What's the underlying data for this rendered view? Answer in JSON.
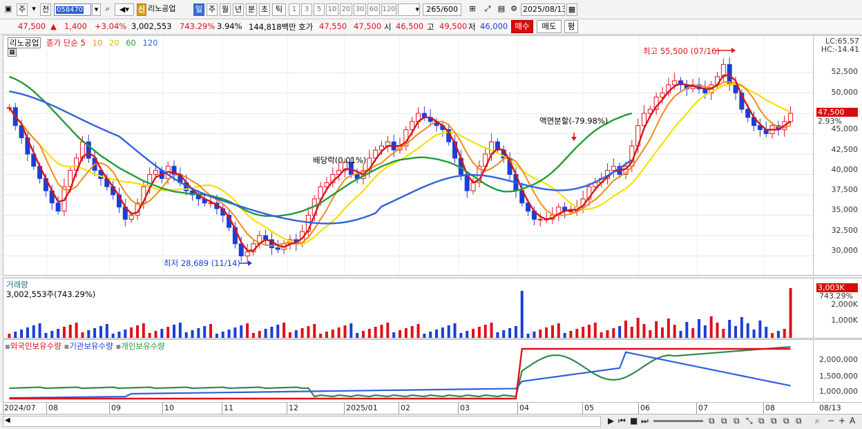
{
  "toolbar": {
    "tab_stock": "주",
    "tab_prev": "전",
    "code": "058470",
    "shin": "신",
    "name": "리노공업",
    "periods": [
      "일",
      "주",
      "월",
      "년",
      "분",
      "초",
      "틱"
    ],
    "intervals": [
      "1",
      "3",
      "5",
      "10",
      "20",
      "30",
      "60",
      "120"
    ],
    "count": "265",
    "count_total": "/600",
    "date": "2025/08/13"
  },
  "quote": {
    "price": "47,500",
    "change": "1,400",
    "change_pct": "+3.04%",
    "volume": "3,002,553",
    "vol_ratio": "743.29%",
    "turnover": "3.94%",
    "amount": "144,818백만",
    "ask_label": "호가",
    "ask1": "47,550",
    "ask2": "47,500",
    "open_label": "시",
    "open": "46,500",
    "high_label": "고",
    "high": "49,500",
    "low_label": "저",
    "low": "46,000",
    "buy_label": "매수",
    "sell_label": "매도",
    "avg_label": "평"
  },
  "legend": {
    "name": "리노공업",
    "series": "종가 단순",
    "ma5": "5",
    "ma10": "10",
    "ma20": "20",
    "ma60": "60",
    "ma120": "120"
  },
  "colors": {
    "up": "#e0101a",
    "down": "#1a3ed8",
    "ma5": "#d81414",
    "ma10": "#f08a1c",
    "ma20": "#f5e000",
    "ma60": "#1f9a3a",
    "ma120": "#3060e0"
  },
  "annotations": {
    "high": "최고 55,500 (07/16)",
    "low": "최저 28,689 (11/14)",
    "dividend": "배당락(0.01%)",
    "split": "액면분할(-79.98%)"
  },
  "right_axis": {
    "lc": "LC:65.57",
    "hc": "HC:-14.41",
    "current": "47,500",
    "current_pct": "2.93%",
    "ticks": [
      "52,500",
      "50,000",
      "47,500",
      "45,000",
      "42,500",
      "40,000",
      "37,500",
      "35,000",
      "32,500",
      "30,000"
    ]
  },
  "volume_panel": {
    "title": "거래량",
    "value": "3,002,553주(743.29%)",
    "current": "3,003K",
    "current_pct": "743.29%",
    "ticks": [
      "2,000K",
      "1,000K"
    ]
  },
  "ownership_panel": {
    "foreign": "외국인보유수량",
    "inst": "기관보유수량",
    "indiv": "개인보유수량",
    "ticks": [
      "2,000,000",
      "1,500,000",
      "1,000,000"
    ]
  },
  "x_axis": {
    "labels": [
      "2024/07",
      "08",
      "09",
      "10",
      "11",
      "12",
      "2025/01",
      "02",
      "03",
      "04",
      "05",
      "06",
      "07",
      "08"
    ],
    "right_label": "08/13"
  },
  "chart_data": {
    "type": "candlestick",
    "y_range": [
      27500,
      57000
    ],
    "y_ticks": [
      30000,
      32500,
      35000,
      37500,
      40000,
      42500,
      45000,
      47500,
      50000,
      52500
    ],
    "closes": [
      48200,
      46000,
      44500,
      42500,
      41000,
      39500,
      38000,
      36500,
      35500,
      38500,
      40500,
      42000,
      44000,
      42000,
      40500,
      39500,
      38500,
      37500,
      36000,
      34500,
      35000,
      36500,
      38500,
      40000,
      40500,
      39500,
      41000,
      40000,
      39000,
      38000,
      37500,
      37000,
      36500,
      36500,
      35800,
      35000,
      33500,
      31500,
      30000,
      30500,
      31500,
      32500,
      32000,
      31000,
      30800,
      31500,
      32000,
      31500,
      33000,
      35000,
      37000,
      38500,
      39000,
      40000,
      40500,
      41500,
      40000,
      39500,
      40500,
      42000,
      43000,
      43500,
      44000,
      43000,
      43500,
      45500,
      46500,
      47500,
      47000,
      46500,
      46000,
      45500,
      44000,
      42000,
      40000,
      38000,
      39000,
      41000,
      42500,
      44000,
      43000,
      42000,
      40000,
      38000,
      36500,
      35500,
      34500,
      34500,
      34500,
      35000,
      36000,
      35500,
      35500,
      36000,
      37000,
      38500,
      39000,
      39500,
      40500,
      41000,
      40000,
      41000,
      43500,
      46000,
      47500,
      48000,
      49500,
      50000,
      51000,
      51500,
      51000,
      50500,
      51000,
      50500,
      50000,
      51000,
      52000,
      53500,
      51000,
      50000,
      48000,
      47000,
      46000,
      45500,
      45000,
      46000,
      45500,
      46500,
      47500
    ],
    "ma60": [
      52000,
      51700,
      51300,
      50800,
      50200,
      49500,
      48800,
      48000,
      47200,
      46400,
      45600,
      44800,
      44100,
      43500,
      42900,
      42300,
      41800,
      41300,
      40800,
      40400,
      40000,
      39600,
      39200,
      38900,
      38600,
      38300,
      38100,
      37900,
      37800,
      37700,
      37600,
      37600,
      37500,
      37400,
      37200,
      37000,
      36700,
      36300,
      35900,
      35500,
      35200,
      35000,
      34900,
      34900,
      34900,
      35000,
      35100,
      35300,
      35500,
      35800,
      36100,
      36500,
      37000,
      37500,
      38000,
      38500,
      39000,
      39400,
      39800,
      40200,
      40600,
      41000,
      41300,
      41600,
      41800,
      41900,
      42000,
      42100,
      42100,
      42000,
      41900,
      41700,
      41500,
      41200,
      40800,
      40300,
      39800,
      39300,
      38800,
      38400,
      38100,
      37900,
      37900,
      38000,
      38200,
      38500,
      38800,
      39200,
      39700,
      40300,
      41000,
      41800,
      42600,
      43400,
      44100,
      44800,
      45400,
      45900,
      46300,
      46700,
      47000,
      47300,
      47500
    ]
  }
}
